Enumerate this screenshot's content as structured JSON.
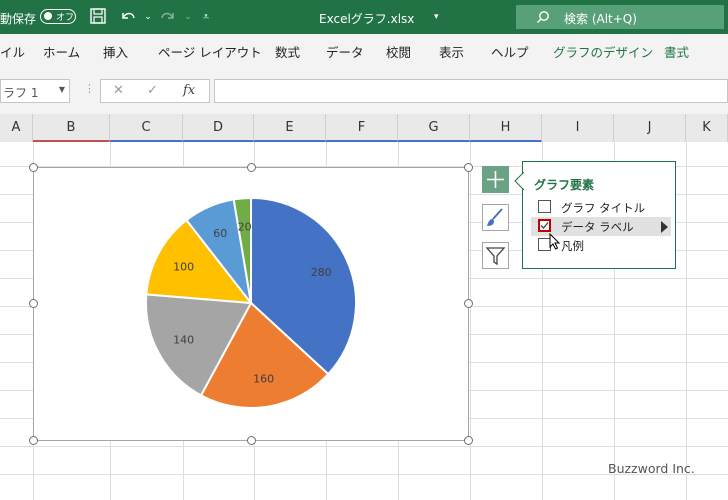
{
  "titlebar": {
    "autosave_label": "動保存",
    "autosave_state": "オフ",
    "filename": "Excelグラフ.xlsx",
    "search_placeholder": "検索 (Alt+Q)"
  },
  "ribbon": {
    "tabs": [
      "イル",
      "ホーム",
      "挿入",
      "ページ レイアウト",
      "数式",
      "データ",
      "校閲",
      "表示",
      "ヘルプ",
      "グラフのデザイン",
      "書式"
    ]
  },
  "formula_bar": {
    "name_box": "ラフ 1",
    "fx": "fx"
  },
  "columns": [
    "A",
    "B",
    "C",
    "D",
    "E",
    "F",
    "G",
    "H",
    "I",
    "J",
    "K"
  ],
  "chart_data": {
    "type": "pie",
    "categories": [
      "",
      "",
      "",
      "",
      ""
    ],
    "values": [
      280,
      160,
      140,
      100,
      60,
      20
    ],
    "colors": [
      "#4472c4",
      "#ed7d31",
      "#a5a5a5",
      "#ffc000",
      "#5b9bd5",
      "#70ad47"
    ],
    "labels": [
      "280",
      "160",
      "140",
      "100",
      "60",
      "20"
    ]
  },
  "popup": {
    "title": "グラフ要素",
    "items": [
      {
        "label": "グラフ タイトル",
        "checked": false
      },
      {
        "label": "データ ラベル",
        "checked": true
      },
      {
        "label": "凡例",
        "checked": false
      }
    ]
  },
  "watermark": "Buzzword Inc."
}
